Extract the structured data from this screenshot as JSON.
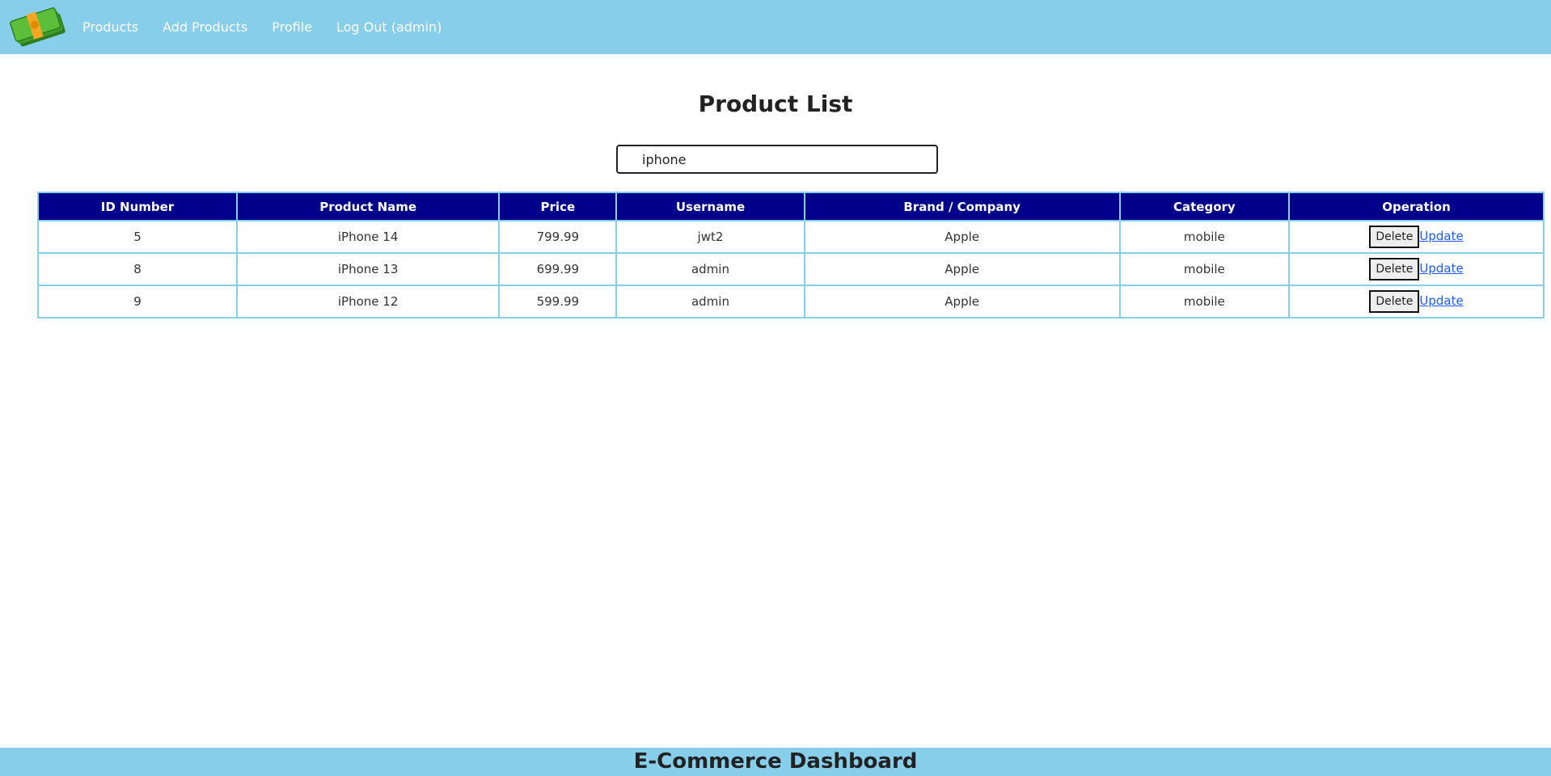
{
  "nav": {
    "links": [
      "Products",
      "Add Products",
      "Profile",
      "Log Out (admin)"
    ]
  },
  "main": {
    "title": "Product List",
    "search_value": "iphone"
  },
  "table": {
    "headers": [
      "ID Number",
      "Product Name",
      "Price",
      "Username",
      "Brand / Company",
      "Category",
      "Operation"
    ],
    "rows": [
      {
        "id": "5",
        "name": "iPhone 14",
        "price": "799.99",
        "username": "jwt2",
        "brand": "Apple",
        "category": "mobile"
      },
      {
        "id": "8",
        "name": "iPhone 13",
        "price": "699.99",
        "username": "admin",
        "brand": "Apple",
        "category": "mobile"
      },
      {
        "id": "9",
        "name": "iPhone 12",
        "price": "599.99",
        "username": "admin",
        "brand": "Apple",
        "category": "mobile"
      }
    ],
    "delete_label": "Delete",
    "update_label": "Update"
  },
  "footer": {
    "text": "E-Commerce Dashboard"
  },
  "colors": {
    "navbar": "#87ceeb",
    "table_header": "#00008b",
    "border": "#87ceeb"
  }
}
